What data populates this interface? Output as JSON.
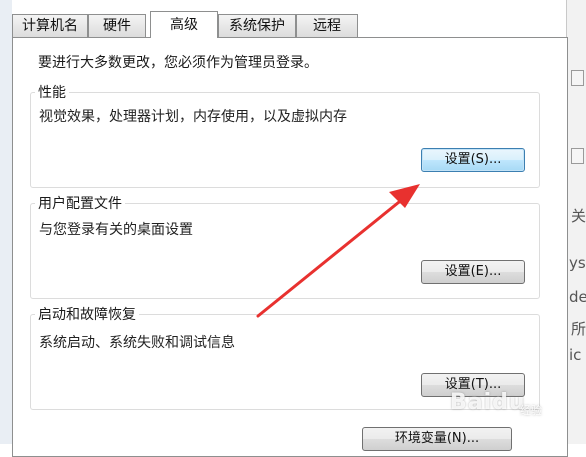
{
  "tabs": [
    {
      "label": "计算机名"
    },
    {
      "label": "硬件"
    },
    {
      "label": "高级"
    },
    {
      "label": "系统保护"
    },
    {
      "label": "远程"
    }
  ],
  "active_tab": "高级",
  "admin_note": "要进行大多数更改，您必须作为管理员登录。",
  "groups": {
    "performance": {
      "title": "性能",
      "description": "视觉效果，处理器计划，内存使用，以及虚拟内存",
      "button": "设置(S)..."
    },
    "user_profiles": {
      "title": "用户配置文件",
      "description": "与您登录有关的桌面设置",
      "button": "设置(E)..."
    },
    "startup_recovery": {
      "title": "启动和故障恢复",
      "description": "系统启动、系统失败和调试信息",
      "button": "设置(T)..."
    }
  },
  "env_button": "环境变量(N)...",
  "background_fragments": [
    "关",
    "ys",
    "de",
    "所",
    "ic"
  ],
  "watermark": {
    "brand": "Baidu",
    "sub": "经验"
  },
  "colors": {
    "arrow": "#e8312f",
    "focus_button": "#bee6fd"
  }
}
